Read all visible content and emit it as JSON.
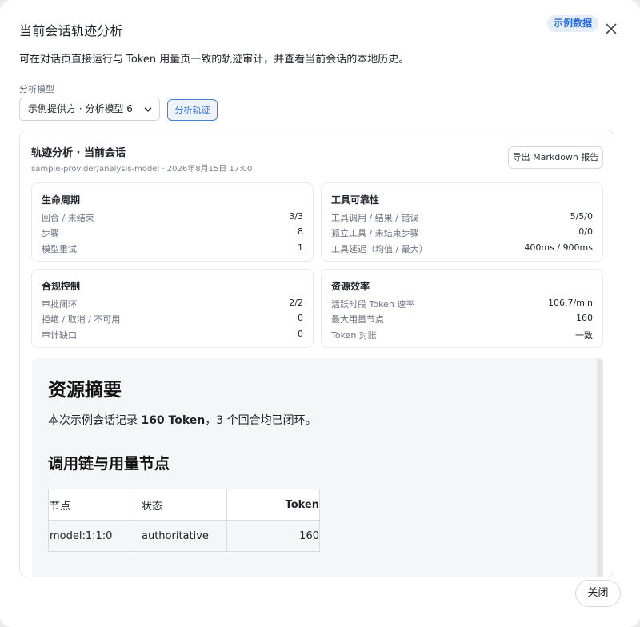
{
  "dialog": {
    "title": "当前会话轨迹分析",
    "badge": "示例数据",
    "description": "可在对话页直接运行与 Token 用量页一致的轨迹审计，并查看当前会话的本地历史。",
    "model_label": "分析模型",
    "model_selected": "示例提供方 · 分析模型 6",
    "analyze_button": "分析轨迹",
    "close_button": "关闭"
  },
  "panel": {
    "title": "轨迹分析 · 当前会话",
    "subtitle": "sample-provider/analysis-model · 2026年8月15日 17:00",
    "export_button": "导出 Markdown 报告",
    "cards": [
      {
        "title": "生命周期",
        "rows": [
          {
            "label": "回合 / 未结束",
            "value": "3/3"
          },
          {
            "label": "步骤",
            "value": "8"
          },
          {
            "label": "模型重试",
            "value": "1"
          }
        ]
      },
      {
        "title": "工具可靠性",
        "rows": [
          {
            "label": "工具调用 / 结果 / 错误",
            "value": "5/5/0"
          },
          {
            "label": "孤立工具 / 未结束步骤",
            "value": "0/0"
          },
          {
            "label": "工具延迟（均值 / 最大）",
            "value": "400ms / 900ms"
          }
        ]
      },
      {
        "title": "合规控制",
        "rows": [
          {
            "label": "审批闭环",
            "value": "2/2"
          },
          {
            "label": "拒绝 / 取消 / 不可用",
            "value": "0"
          },
          {
            "label": "审计缺口",
            "value": "0"
          }
        ]
      },
      {
        "title": "资源效率",
        "rows": [
          {
            "label": "活跃时段 Token 速率",
            "value": "106.7/min"
          },
          {
            "label": "最大用量节点",
            "value": "160"
          },
          {
            "label": "Token 对账",
            "value": "一致"
          }
        ]
      }
    ]
  },
  "report": {
    "h1": "资源摘要",
    "p_prefix": "本次示例会话记录 ",
    "p_bold": "160 Token",
    "p_suffix": "，3 个回合均已闭环。",
    "h2": "调用链与用量节点",
    "table": {
      "headers": [
        "节点",
        "状态",
        "Token"
      ],
      "rows": [
        [
          "model:1:1:0",
          "authoritative",
          "160"
        ]
      ]
    }
  },
  "icons": {
    "close": "close-icon",
    "dropdown": "chevron-down-icon"
  },
  "colors": {
    "accent": "#2f6fd6",
    "badge_bg": "#e4eefc"
  }
}
